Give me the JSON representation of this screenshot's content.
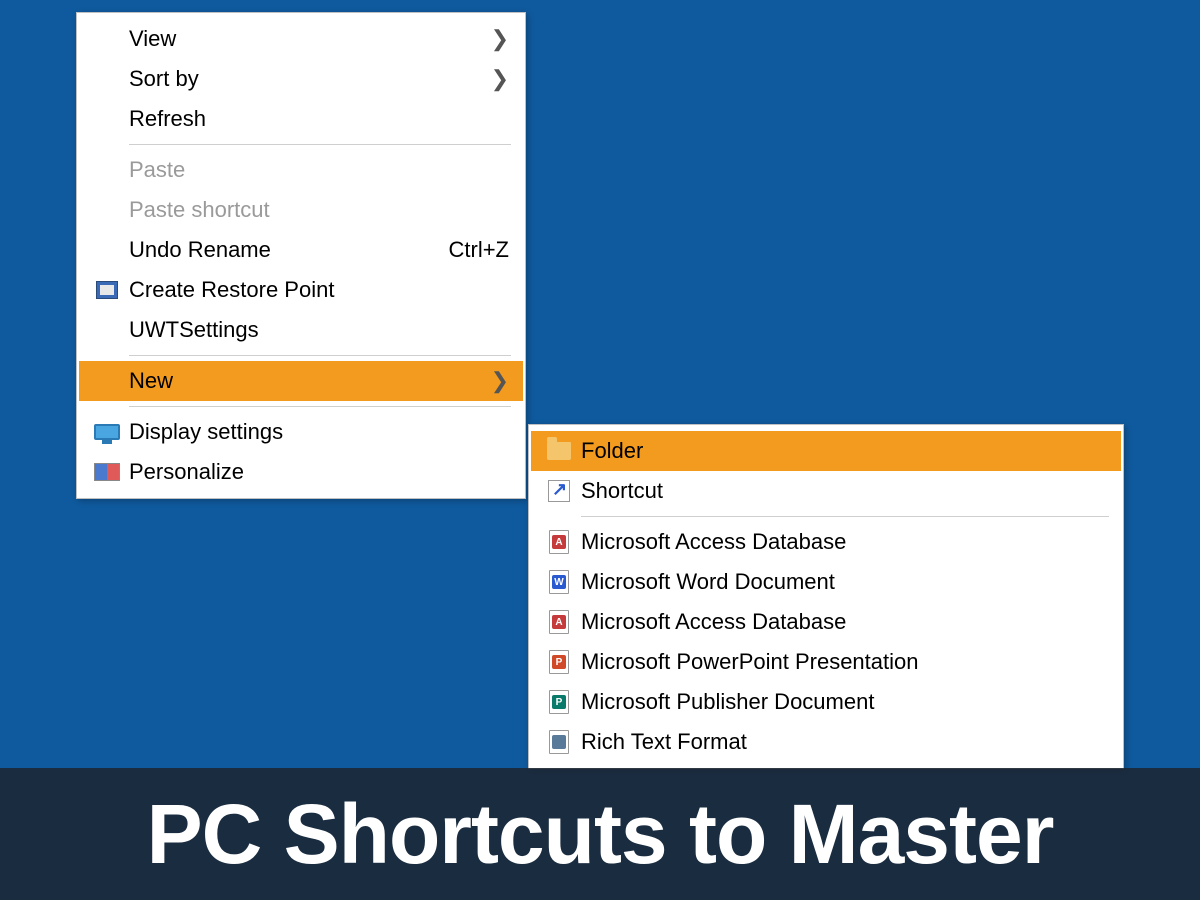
{
  "colors": {
    "desktop_bg": "#0f5a9e",
    "highlight": "#f39b1f"
  },
  "primary_menu": {
    "items": [
      {
        "label": "View",
        "has_arrow": true,
        "icon": null,
        "disabled": false
      },
      {
        "label": "Sort by",
        "has_arrow": true,
        "icon": null,
        "disabled": false
      },
      {
        "label": "Refresh",
        "has_arrow": false,
        "icon": null,
        "disabled": false
      },
      {
        "separator": true
      },
      {
        "label": "Paste",
        "has_arrow": false,
        "icon": null,
        "disabled": true
      },
      {
        "label": "Paste shortcut",
        "has_arrow": false,
        "icon": null,
        "disabled": true
      },
      {
        "label": "Undo Rename",
        "has_arrow": false,
        "shortcut": "Ctrl+Z",
        "icon": null,
        "disabled": false
      },
      {
        "label": "Create Restore Point",
        "has_arrow": false,
        "icon": "restore",
        "disabled": false
      },
      {
        "label": "UWTSettings",
        "has_arrow": false,
        "icon": null,
        "disabled": false
      },
      {
        "separator": true
      },
      {
        "label": "New",
        "has_arrow": true,
        "icon": null,
        "highlighted": true,
        "disabled": false
      },
      {
        "separator": true
      },
      {
        "label": "Display settings",
        "has_arrow": false,
        "icon": "display",
        "disabled": false
      },
      {
        "label": "Personalize",
        "has_arrow": false,
        "icon": "personalize",
        "disabled": false
      }
    ]
  },
  "sub_menu": {
    "items": [
      {
        "label": "Folder",
        "icon": "folder",
        "highlighted": true
      },
      {
        "label": "Shortcut",
        "icon": "shortcut"
      },
      {
        "separator": true
      },
      {
        "label": "Microsoft Access Database",
        "icon": "doc",
        "badge": "access",
        "badge_text": "A"
      },
      {
        "label": "Microsoft Word Document",
        "icon": "doc",
        "badge": "word",
        "badge_text": "W"
      },
      {
        "label": "Microsoft Access Database",
        "icon": "doc",
        "badge": "access",
        "badge_text": "A"
      },
      {
        "label": "Microsoft PowerPoint Presentation",
        "icon": "doc",
        "badge": "ppt",
        "badge_text": "P"
      },
      {
        "label": "Microsoft Publisher Document",
        "icon": "doc",
        "badge": "pub",
        "badge_text": "P"
      },
      {
        "label": "Rich Text Format",
        "icon": "doc",
        "badge": "rtf",
        "badge_text": ""
      }
    ]
  },
  "caption": "PC Shortcuts to Master"
}
